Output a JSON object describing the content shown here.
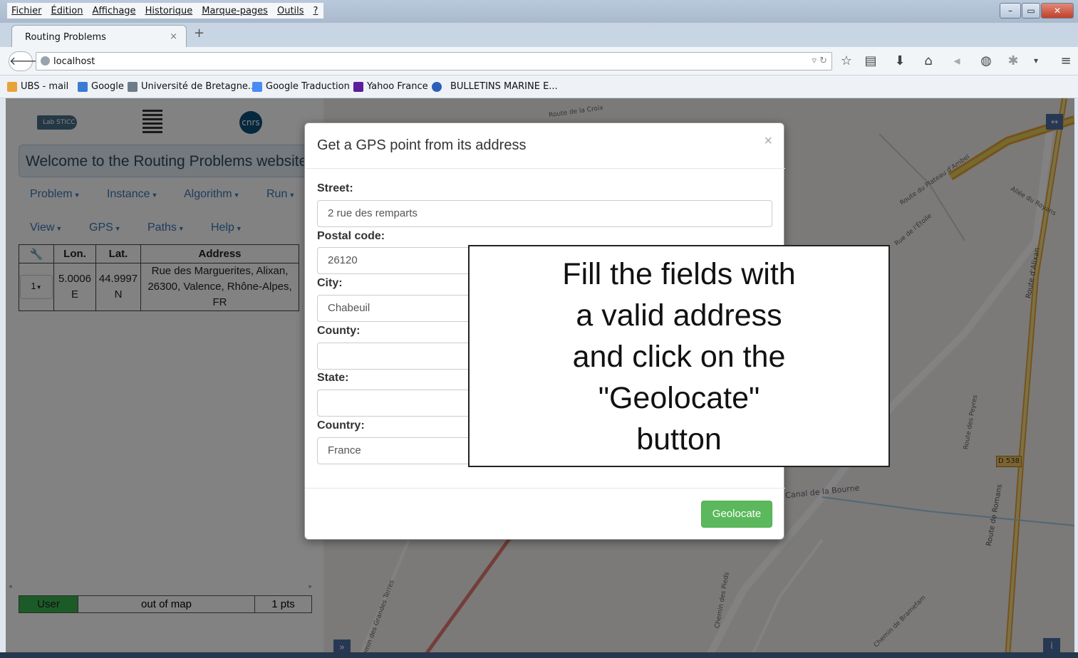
{
  "browser": {
    "menu": [
      "Fichier",
      "Édition",
      "Affichage",
      "Historique",
      "Marque-pages",
      "Outils",
      "?"
    ],
    "tab_title": "Routing Problems",
    "tab_close": "×",
    "new_tab": "+",
    "url": "localhost",
    "bookmarks": [
      "UBS - mail",
      "Google",
      "Université de Bretagne...",
      "Google Traduction",
      "Yahoo France",
      "BULLETINS MARINE E..."
    ]
  },
  "sidebar": {
    "logo1": "Lab STICC",
    "logo3": "cnrs",
    "welcome": "Welcome to the Routing Problems website !",
    "nav_row1": [
      "Problem",
      "Instance",
      "Algorithm",
      "Run"
    ],
    "nav_row2": [
      "View",
      "GPS",
      "Paths",
      "Help"
    ],
    "table": {
      "headers": [
        "Lon.",
        "Lat.",
        "Address"
      ],
      "row": {
        "button": "1",
        "lon": "5.0006 E",
        "lat": "44.9997 N",
        "address": "Rue des Marguerites, Alixan, 26300, Valence, Rhône-Alpes, FR"
      }
    },
    "status": {
      "user": "User",
      "location": "out of map",
      "points": "1 pts"
    }
  },
  "map": {
    "labels": [
      "Route de la Croix",
      "Route du Plateau d'Ambel",
      "D 538",
      "Route de Romans",
      "Route d'Alixan",
      "Canal de la Bourne",
      "Chemin des Grandes Terres",
      "Chemin des Pieds",
      "Chemin de Bramefam",
      "Rue de l'Étoile",
      "Allée du Royans",
      "Route des Peyres"
    ],
    "expand_btn": "»",
    "info_btn": "i",
    "fullscreen_btn": "↔"
  },
  "modal": {
    "title": "Get a GPS point from its address",
    "close": "×",
    "fields": [
      {
        "label": "Street:",
        "value": "2 rue des remparts"
      },
      {
        "label": "Postal code:",
        "value": "26120"
      },
      {
        "label": "City:",
        "value": "Chabeuil"
      },
      {
        "label": "County:",
        "value": ""
      },
      {
        "label": "State:",
        "value": ""
      },
      {
        "label": "Country:",
        "value": "France"
      }
    ],
    "button": "Geolocate"
  },
  "callout": {
    "lines": [
      "Fill the fields with",
      "a valid address",
      "and click on the",
      "\"Geolocate\"",
      "button"
    ]
  },
  "colors": {
    "accent": "#5cb85c",
    "nav_link": "#3778b8",
    "welcome_bg": "#e1edf6",
    "status_green": "#37b24d"
  }
}
